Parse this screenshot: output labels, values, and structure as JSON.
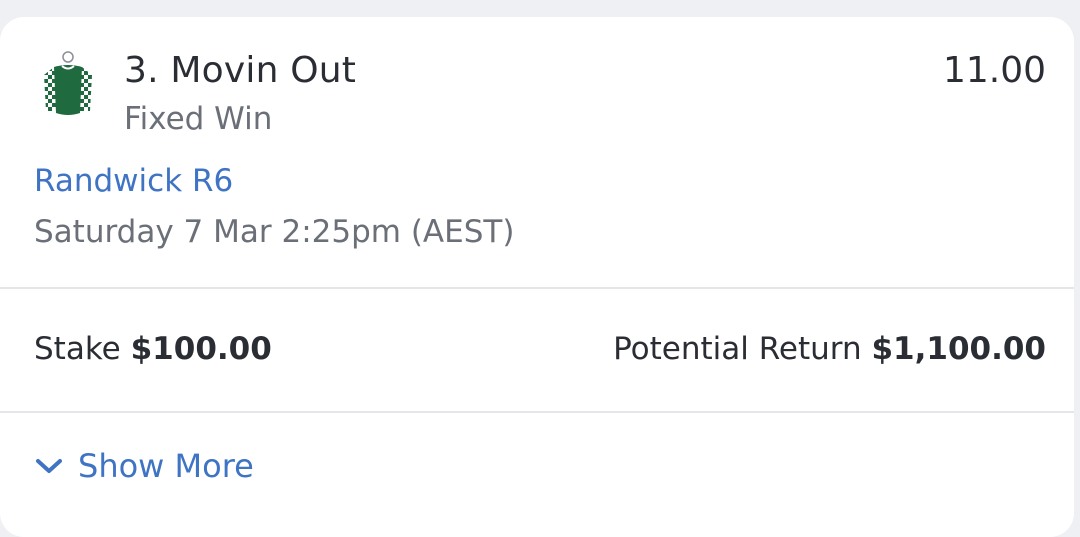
{
  "runner": {
    "name": "3. Movin Out",
    "bet_type": "Fixed Win",
    "odds": "11.00",
    "silks_icon": "jockey-silks-green-white-checks"
  },
  "race": {
    "venue_link": "Randwick R6",
    "start_time": "Saturday 7 Mar 2:25pm (AEST)"
  },
  "bet": {
    "stake_label": "Stake",
    "stake_amount": "$100.00",
    "return_label": "Potential Return",
    "return_amount": "$1,100.00"
  },
  "footer": {
    "show_more_label": "Show More",
    "icon": "chevron-down-icon"
  },
  "colors": {
    "link": "#3f74c4",
    "text_primary": "#2a2d33",
    "text_secondary": "#6b6f78",
    "silks_green": "#1f6b3f"
  }
}
